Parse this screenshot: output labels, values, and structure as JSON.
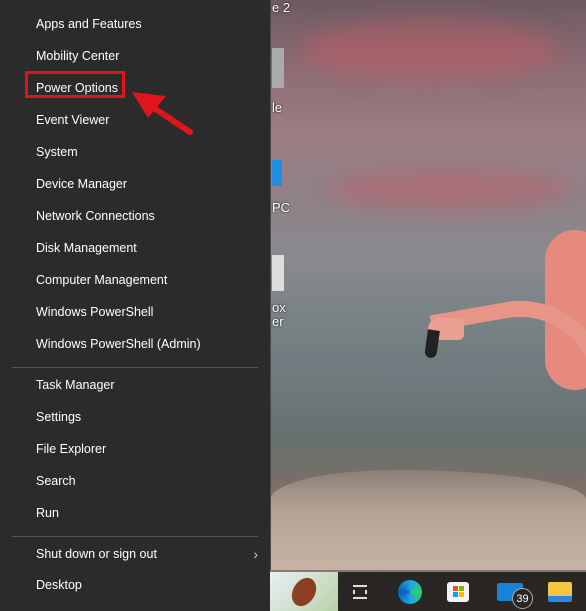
{
  "menu": {
    "groups": [
      [
        "Apps and Features",
        "Mobility Center",
        "Power Options",
        "Event Viewer",
        "System",
        "Device Manager",
        "Network Connections",
        "Disk Management",
        "Computer Management",
        "Windows PowerShell",
        "Windows PowerShell (Admin)"
      ],
      [
        "Task Manager",
        "Settings",
        "File Explorer",
        "Search",
        "Run"
      ],
      [
        "Shut down or sign out",
        "Desktop"
      ]
    ],
    "highlighted_item": "Power Options",
    "shutdown_has_submenu": true
  },
  "desktop_labels": [
    "e 2",
    "le",
    "PC",
    "ox",
    "er"
  ],
  "taskbar": {
    "icons": [
      "football-widget-icon",
      "task-view-icon",
      "edge-icon",
      "store-icon",
      "mail-icon",
      "file-explorer-icon"
    ],
    "mail_badge": "39"
  },
  "annotation": {
    "color": "#e0141c"
  }
}
